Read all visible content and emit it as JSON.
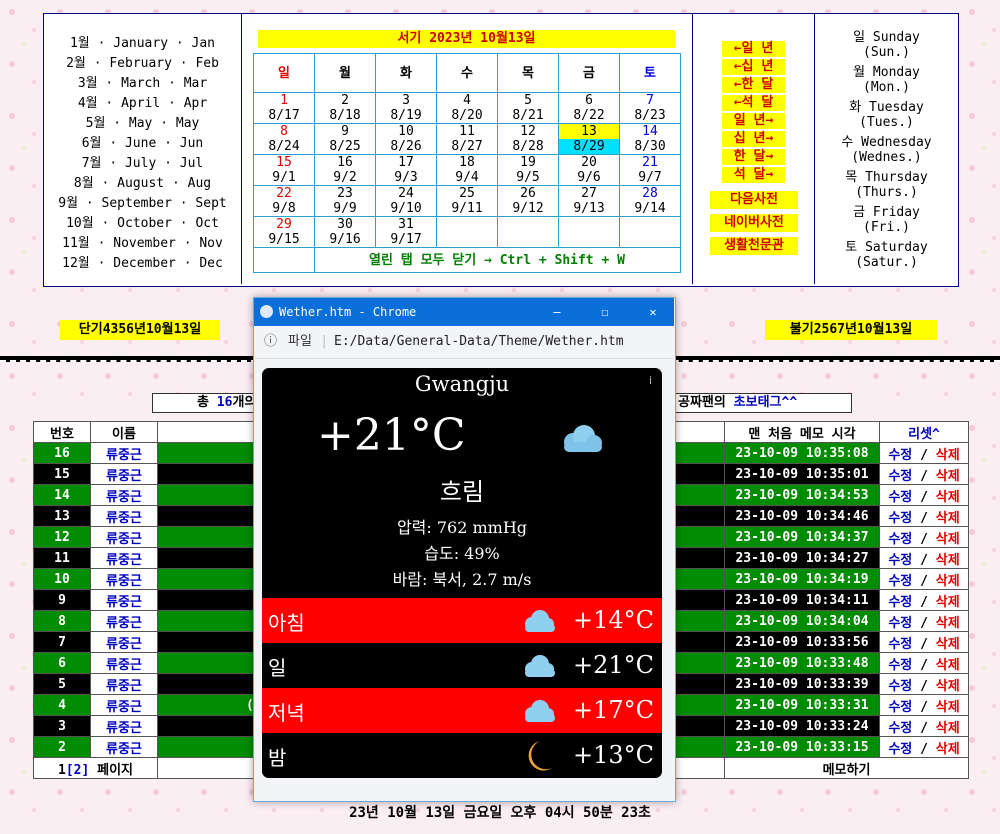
{
  "months": [
    "1월 · January · Jan",
    "2월 · February · Feb",
    "3월 · March · Mar",
    "4월 · April · Apr",
    "5월 · May · May",
    "6월 · June · Jun",
    "7월 · July · Jul",
    "8월 · August · Aug",
    "9월 · September · Sept",
    "10월 · October · Oct",
    "11월 · November · Nov",
    "12월 · December · Dec"
  ],
  "calendar": {
    "title": "서기 2023년 10월13일",
    "headers": [
      "일",
      "월",
      "화",
      "수",
      "목",
      "금",
      "토"
    ],
    "rows": [
      [
        [
          "1",
          "8/17"
        ],
        [
          "2",
          "8/18"
        ],
        [
          "3",
          "8/19"
        ],
        [
          "4",
          "8/20"
        ],
        [
          "5",
          "8/21"
        ],
        [
          "6",
          "8/22"
        ],
        [
          "7",
          "8/23"
        ]
      ],
      [
        [
          "8",
          "8/24"
        ],
        [
          "9",
          "8/25"
        ],
        [
          "10",
          "8/26"
        ],
        [
          "11",
          "8/27"
        ],
        [
          "12",
          "8/28"
        ],
        [
          "13",
          "8/29"
        ],
        [
          "14",
          "8/30"
        ]
      ],
      [
        [
          "15",
          "9/1"
        ],
        [
          "16",
          "9/2"
        ],
        [
          "17",
          "9/3"
        ],
        [
          "18",
          "9/4"
        ],
        [
          "19",
          "9/5"
        ],
        [
          "20",
          "9/6"
        ],
        [
          "21",
          "9/7"
        ]
      ],
      [
        [
          "22",
          "9/8"
        ],
        [
          "23",
          "9/9"
        ],
        [
          "24",
          "9/10"
        ],
        [
          "25",
          "9/11"
        ],
        [
          "26",
          "9/12"
        ],
        [
          "27",
          "9/13"
        ],
        [
          "28",
          "9/14"
        ]
      ],
      [
        [
          "29",
          "9/15"
        ],
        [
          "30",
          "9/16"
        ],
        [
          "31",
          "9/17"
        ],
        [
          "",
          ""
        ],
        [
          "",
          ""
        ],
        [
          "",
          ""
        ],
        [
          "",
          ""
        ]
      ]
    ],
    "close_all": "열린 탭 모두 닫기 → Ctrl + Shift + W"
  },
  "nav": [
    "←일 년",
    "←십 년",
    "←한 달",
    "←석 달",
    "일 년→",
    "십 년→",
    "한 달→",
    "석 달→"
  ],
  "dict_buttons": [
    "다음사전",
    "네이버사전",
    "생활천문관"
  ],
  "weekdays": [
    [
      "일 Sunday",
      "(Sun.)"
    ],
    [
      "월 Monday",
      "(Mon.)"
    ],
    [
      "화 Tuesday",
      "(Tues.)"
    ],
    [
      "수 Wednesday",
      "(Wednes.)"
    ],
    [
      "목 Thursday",
      "(Thurs.)"
    ],
    [
      "금 Friday",
      "(Fri.)"
    ],
    [
      "토 Saturday",
      "(Satur.)"
    ]
  ],
  "dangi": "단기4356년10월13일",
  "bulgi": "불기2567년10월13일",
  "memo": {
    "bar_left_prefix": "총 ",
    "bar_left_count": "16",
    "bar_left_suffix": "개의",
    "bar_right_prefix": "공짜팬의 ",
    "bar_right_link": "초보태그^^",
    "headers": {
      "num": "번호",
      "name": "이름",
      "time": "맨 처음 메모 시각",
      "reset": "리셋^"
    },
    "rows": [
      {
        "num": "16",
        "name": "류중근",
        "time": "23-10-09 10:35:08"
      },
      {
        "num": "15",
        "name": "류중근",
        "time": "23-10-09 10:35:01"
      },
      {
        "num": "14",
        "name": "류중근",
        "time": "23-10-09 10:34:53"
      },
      {
        "num": "13",
        "name": "류중근",
        "time": "23-10-09 10:34:46"
      },
      {
        "num": "12",
        "name": "류중근",
        "time": "23-10-09 10:34:37"
      },
      {
        "num": "11",
        "name": "류중근",
        "time": "23-10-09 10:34:27"
      },
      {
        "num": "10",
        "name": "류중근",
        "time": "23-10-09 10:34:19"
      },
      {
        "num": "9",
        "name": "류중근",
        "time": "23-10-09 10:34:11"
      },
      {
        "num": "8",
        "name": "류중근",
        "time": "23-10-09 10:34:04"
      },
      {
        "num": "7",
        "name": "류중근",
        "time": "23-10-09 10:33:56"
      },
      {
        "num": "6",
        "name": "류중근",
        "time": "23-10-09 10:33:48"
      },
      {
        "num": "5",
        "name": "류중근",
        "time": "23-10-09 10:33:39"
      },
      {
        "num": "4",
        "name": "류중근",
        "time": "23-10-09 10:33:31"
      },
      {
        "num": "3",
        "name": "류중근",
        "time": "23-10-09 10:33:24"
      },
      {
        "num": "2",
        "name": "류중근",
        "time": "23-10-09 10:33:15"
      }
    ],
    "edit_label": "수정",
    "sep": "/",
    "delete_label": "삭제",
    "row4_fragment": "(",
    "page_prefix": "1",
    "page_current": "[2]",
    "page_suffix": " 페이지",
    "write_memo": "메모하기"
  },
  "clock": "23년 10월 13일 금요일 오후 04시 50분 23초",
  "popup": {
    "title": "Wether.htm - Chrome",
    "minimize": "—",
    "maximize": "☐",
    "close": "✕",
    "info_icon_glyph": "ⓘ",
    "address_label": "파일",
    "address_sep": "|",
    "url": "E:/Data/General-Data/Theme/Wether.htm"
  },
  "weather": {
    "city": "Gwangju",
    "info": "i",
    "temp": "+21°C",
    "condition": "흐림",
    "pressure": "압력: 762 mmHg",
    "humidity": "습도: 49%",
    "wind": "바람: 북서, 2.7 m/s",
    "forecast": [
      {
        "label": "아침",
        "temp": "+14°C",
        "icon": "cloud-icon",
        "bg": "#ff0000"
      },
      {
        "label": "일",
        "temp": "+21°C",
        "icon": "cloud-icon",
        "bg": "#000000"
      },
      {
        "label": "저녁",
        "temp": "+17°C",
        "icon": "cloud-icon",
        "bg": "#ff0000"
      },
      {
        "label": "밤",
        "temp": "+13°C",
        "icon": "moon-icon",
        "bg": "#000000"
      }
    ]
  },
  "colors": {
    "accent_yellow": "#ffff00",
    "memo_green": "#008c00",
    "sunday": "#e00000",
    "saturday": "#0000e0"
  }
}
